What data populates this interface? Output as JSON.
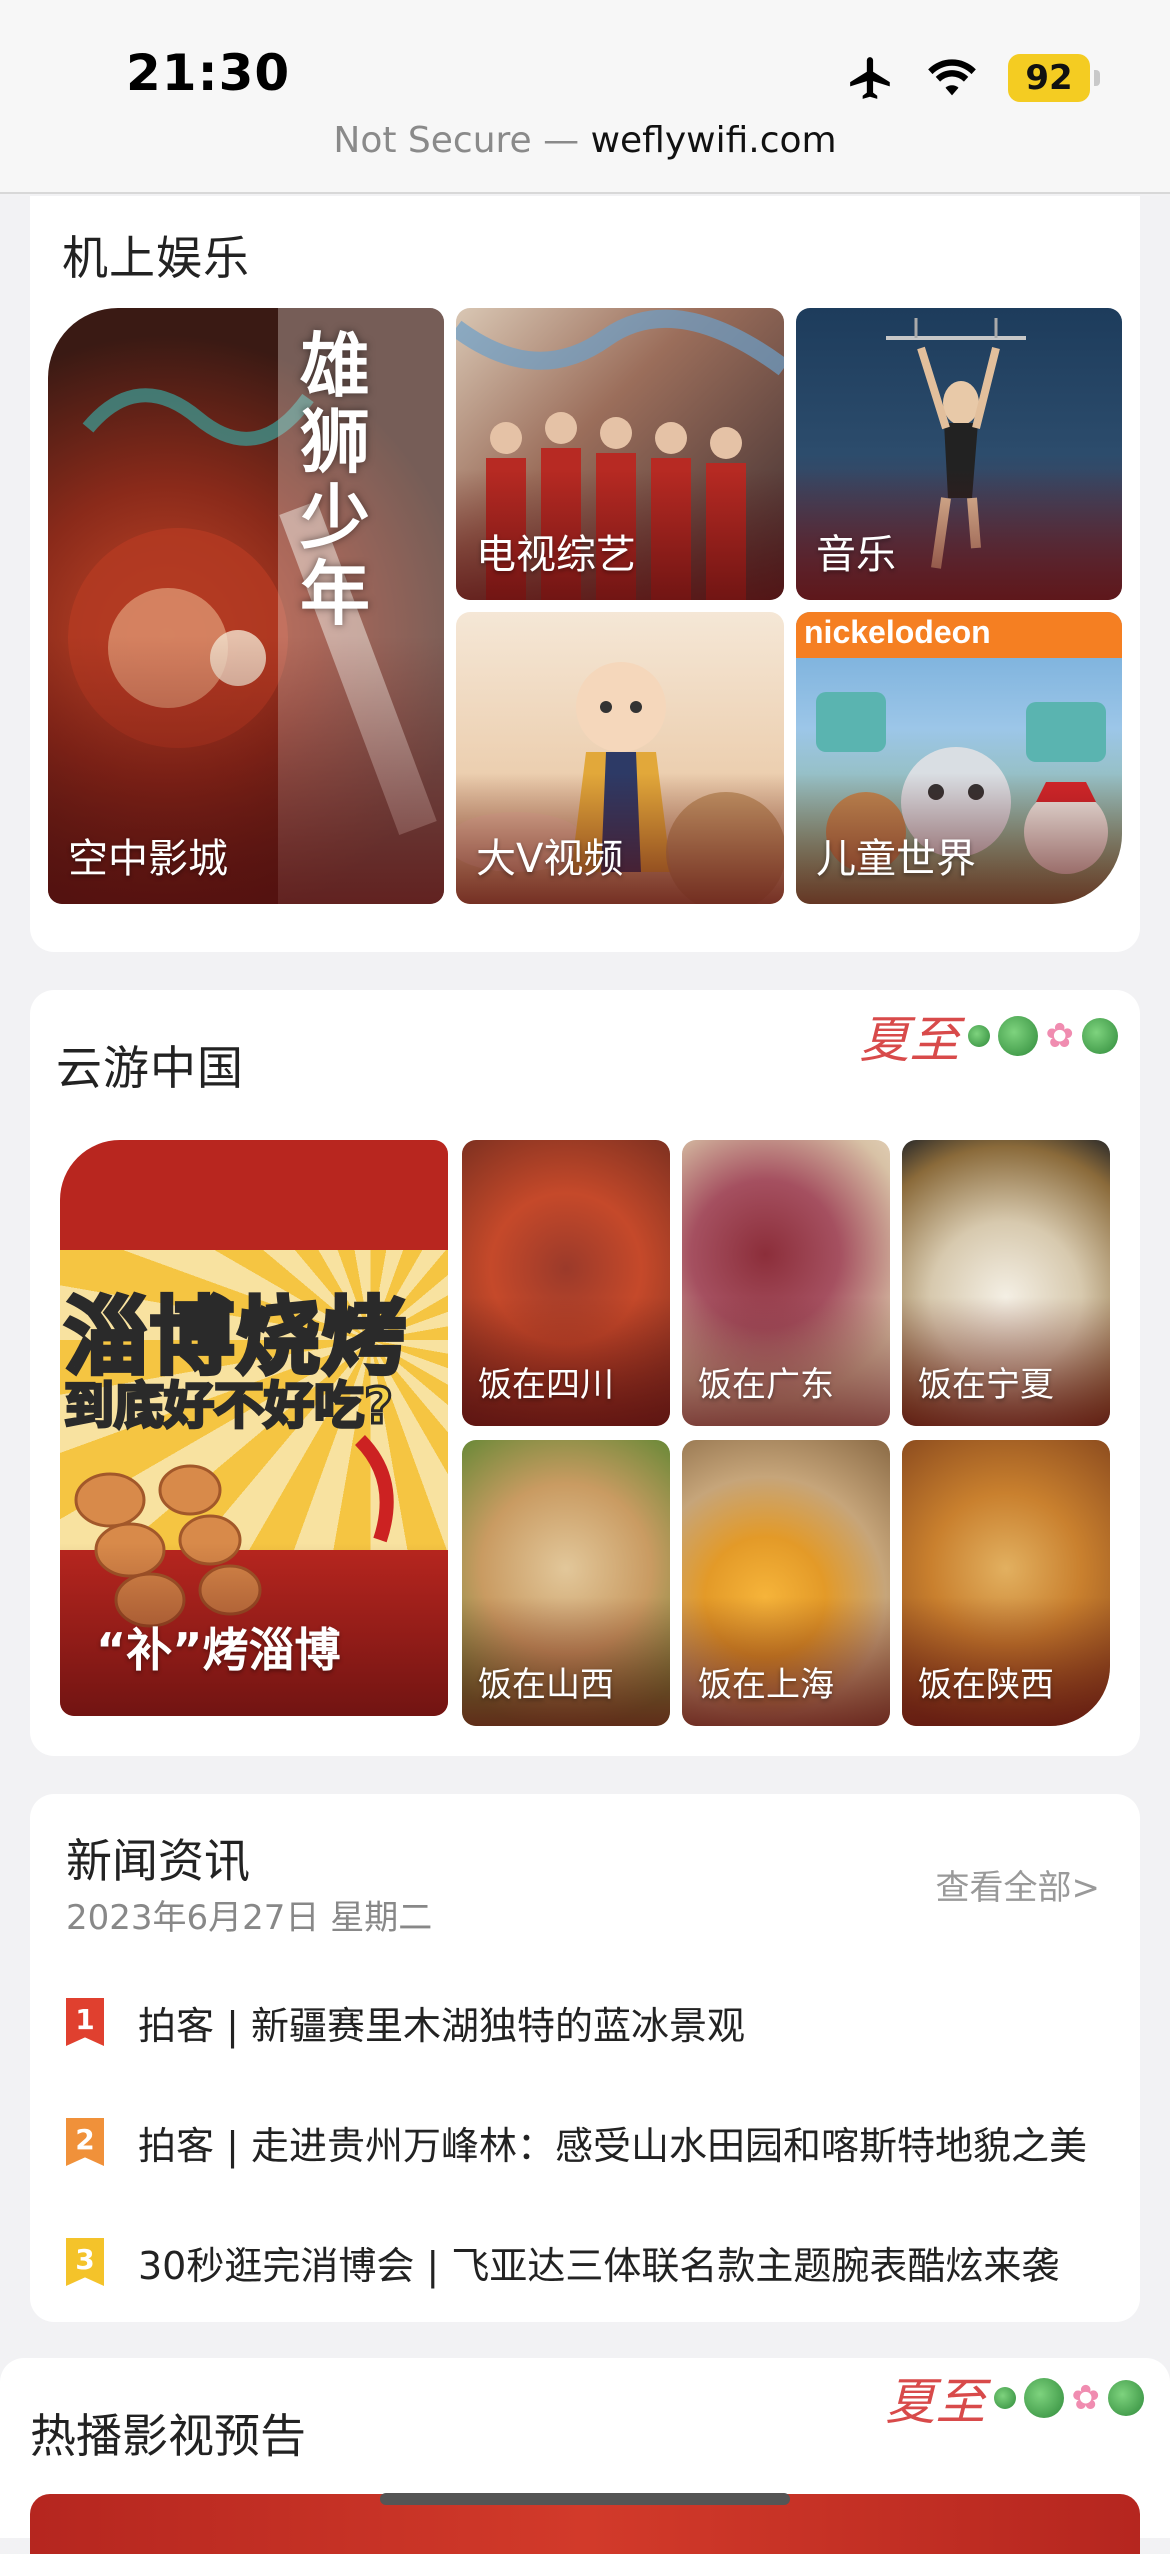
{
  "status_bar": {
    "time": "21:30",
    "battery": "92",
    "url_prefix": "Not Secure — ",
    "url_host": "weflywifi.com",
    "icons": [
      "airplane-icon",
      "wifi-icon",
      "battery-icon"
    ]
  },
  "entertainment": {
    "title": "机上娱乐",
    "tiles": [
      {
        "label": "空中影城"
      },
      {
        "label": "电视综艺"
      },
      {
        "label": "音乐"
      },
      {
        "label": "大V视频"
      },
      {
        "label": "儿童世界"
      }
    ],
    "poster_text": "雄狮少年",
    "nick_logo": "nickelodeon"
  },
  "travel": {
    "title": "云游中国",
    "deco_text": "夏至",
    "feature_label": "“补”烤淄博",
    "feature_headline_1": "淄博烧烤",
    "feature_headline_2": "到底好不好吃?",
    "tiles": [
      {
        "label": "饭在四川"
      },
      {
        "label": "饭在广东"
      },
      {
        "label": "饭在宁夏"
      },
      {
        "label": "饭在山西"
      },
      {
        "label": "饭在上海"
      },
      {
        "label": "饭在陕西"
      }
    ]
  },
  "news": {
    "title": "新闻资讯",
    "date": "2023年6月27日  星期二",
    "more": "查看全部>",
    "items": [
      {
        "rank": "1",
        "text": "拍客 | 新疆赛里木湖独特的蓝冰景观",
        "color": "#e0402f"
      },
      {
        "rank": "2",
        "text": "拍客 | 走进贵州万峰林：感受山水田园和喀斯特地貌之美",
        "color": "#f0913a"
      },
      {
        "rank": "3",
        "text": "30秒逛完消博会 | 飞亚达三体联名款主题腕表酷炫来袭",
        "color": "#f4c32a"
      }
    ]
  },
  "trailers": {
    "title": "热播影视预告",
    "deco_text": "夏至"
  }
}
